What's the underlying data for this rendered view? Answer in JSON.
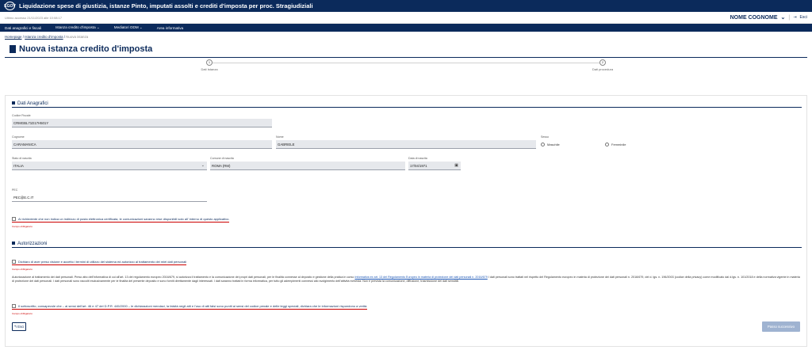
{
  "app": {
    "title": "Liquidazione spese di giustizia, istanze Pinto, imputati assolti e crediti d'imposta per proc. Stragiudiziali",
    "logo_text": "EGOV",
    "last_access": "Ultimo accesso 21/11/2023 alle 10:08:17",
    "user_name": "NOME COGNOME",
    "user_chevron": "⌄",
    "exit_label": "Esci"
  },
  "nav": {
    "items": [
      "Dati anagrafici e fiscali",
      "Istanza credito d'imposta ⌄",
      "Mediatori ODM ⌄",
      "Area informativa"
    ]
  },
  "breadcrumb": {
    "home": "Homepage",
    "sep1": " / ",
    "istanza": "Istanza credito d'imposta",
    "sep2": " / ",
    "current": "Nuova istanza"
  },
  "page": {
    "title": "Nuova istanza credito d'imposta"
  },
  "steps": [
    {
      "num": "1",
      "label": "Dati Istanza"
    },
    {
      "num": "2",
      "label": "Dati procedura"
    }
  ],
  "anagrafici": {
    "section": "Dati Anagrafici",
    "cf_label": "Codice Fiscale",
    "cf_value": "CRMGBL71D17H501Y",
    "cognome_label": "Cognome",
    "cognome_value": "CARAMANICA",
    "nome_label": "Nome",
    "nome_value": "GABRIELE",
    "sesso_label": "Sesso",
    "maschile": "Maschile",
    "femminile": "Femminile",
    "stato_label": "Stato di nascita",
    "stato_value": "ITALIA",
    "comune_label": "Comune di nascita",
    "comune_value": "ROMA (RM)",
    "data_label": "Data di nascita",
    "data_value": "17/04/1971",
    "pec_label": "PEC",
    "pec_value": "PEC@E.C.IT",
    "pec_check": "Ai richiedente che non indica un indirizzo di posta elettronica certificata, le comunicazioni saranno rese disponibili solo all' interno di questo applicativo.",
    "pec_err": "Campo obbligatorio"
  },
  "autorizzazioni": {
    "section": "Autorizzazioni",
    "check1": "Dichiaro di aver preso visione e accetto i termini di utilizzo del sistema ed autorizzo al trattamento dei miei dati personali",
    "check1_err": "Campo obbligatorio",
    "para_a": "Autorizzazione al trattamento dei dati personali. Preso atto dell'informativa di cui all'art. 13 del regolamento europeo 2016/679, si autorizza il trattamento e la comunicazione dei propri dati personali, per le finalità connesse al deposito e gestione della pratica in corso ",
    "para_link": "Informativa ex art. 13 del Regolamento Europeo in materia di protezione dei dati personali n. 2016/679",
    "para_b": " I dati personali sono trattati nel rispetto del Regolamento europeo in materia di protezione dei dati personali n. 2016/679, del d. lgs. n. 196/2003 (codice della privacy) come modificato dal d.lgs. n. 101/2018 e della normativa vigente in materia di protezione dei dati personali. I dati personali sono raccolti esclusivamente per le finalità del presente deposito e sono forniti direttamente dagli interessati. I dati saranno trattati in forma informatica, per tutto gli adempimenti connessi allo svolgimento dell'attività richiesta. Non è prevista la comunicazione, diffusione, trasmissione dei dati sensibili.",
    "check2": "Il sottoscritto, consapevole che – ai sensi dell'art. 46 e 47 del D.P.R. 445/2000 – le dichiarazioni mendaci, la falsità negli atti e l'uso di atti falsi sono puniti ai sensi del codice penale e delle leggi speciali, dichiara che le informazioni rispondono a verità.",
    "check2_err": "Campo obbligatorio"
  },
  "actions": {
    "back_arrow": "↰",
    "back": "Esci",
    "next": "Passo successivo"
  },
  "colors": {
    "primary": "#0b2a5b",
    "error": "#cc0000",
    "field_bg": "#e6e8ec",
    "disabled_btn": "#9fb3d1"
  }
}
